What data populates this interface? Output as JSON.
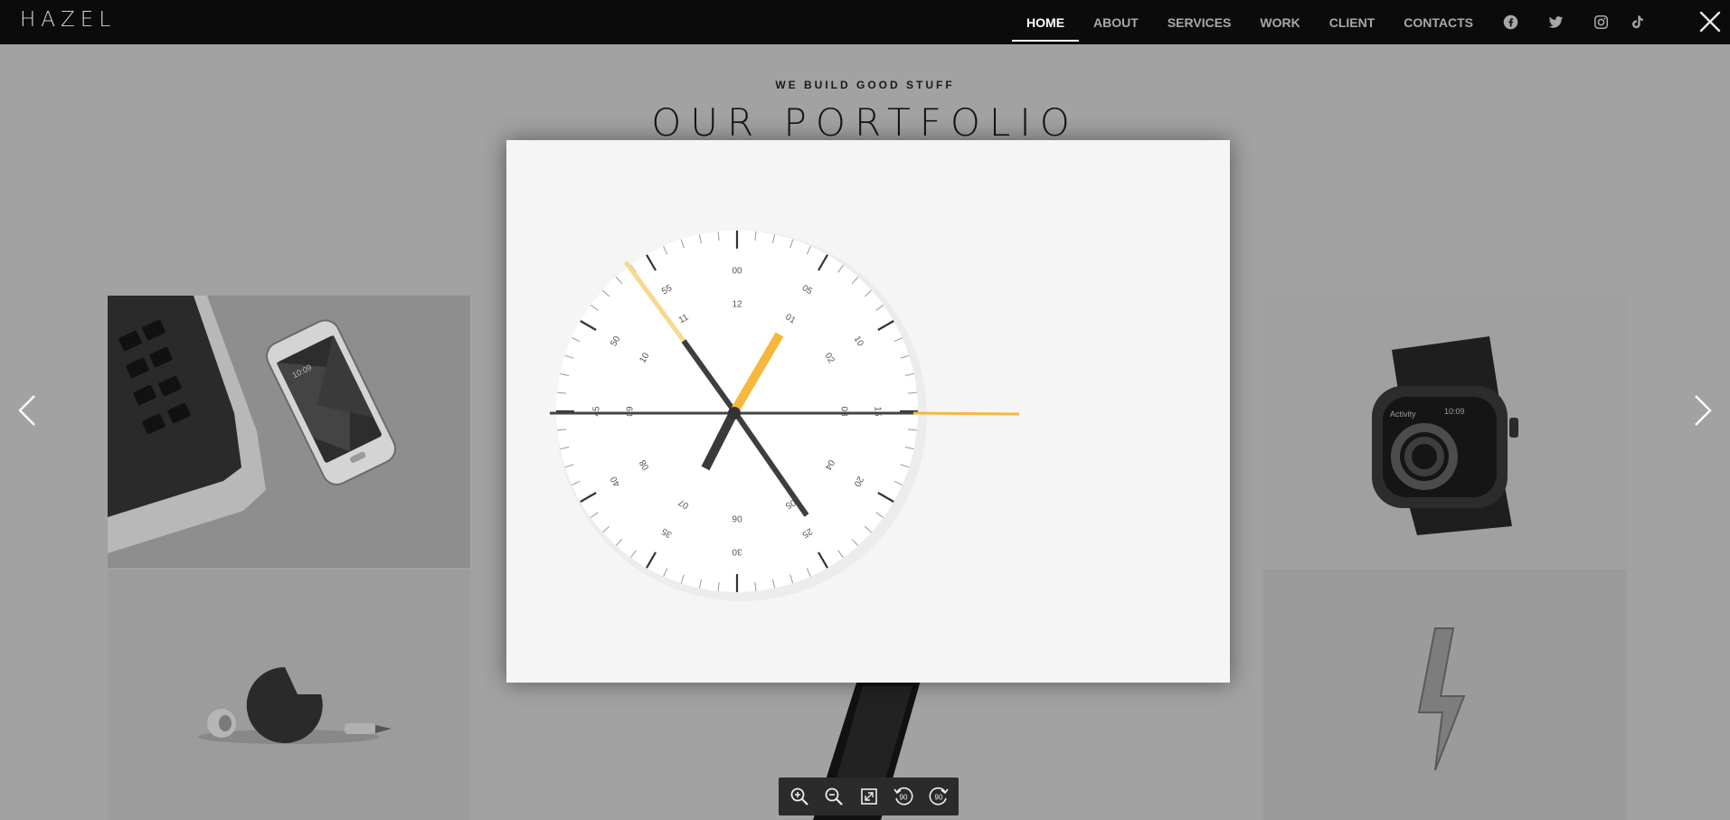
{
  "brand": {
    "logo": "HAZEL"
  },
  "nav": {
    "links": [
      "HOME",
      "ABOUT",
      "SERVICES",
      "WORK",
      "CLIENT",
      "CONTACTS"
    ],
    "active": "HOME",
    "social_icons": [
      "facebook-icon",
      "twitter-icon",
      "instagram-icon",
      "tiktok-icon"
    ]
  },
  "portfolio": {
    "kicker": "WE BUILD GOOD STUFF",
    "heading": "OUR PORTFOLIO"
  },
  "lightbox": {
    "clock": {
      "minute_labels": [
        "00",
        "05",
        "10",
        "15",
        "20",
        "25",
        "30",
        "35",
        "40",
        "45",
        "50",
        "55"
      ],
      "hour_labels": [
        "12",
        "01",
        "02",
        "03",
        "04",
        "05",
        "06",
        "07",
        "08",
        "09",
        "10",
        "11"
      ],
      "accent_color": "#f5b83d"
    },
    "phone_screen_time": "10:09",
    "watch_screen_label": "Activity",
    "watch_screen_time": "10:09",
    "toolbar": [
      "zoom-in-icon",
      "zoom-out-icon",
      "fullscreen-icon",
      "rotate-left-icon",
      "rotate-right-icon"
    ],
    "rotate_label": "90"
  },
  "colors": {
    "overlay": "#9a9a9a",
    "navbar": "#0b0b0b",
    "accent": "#f5b83d"
  }
}
